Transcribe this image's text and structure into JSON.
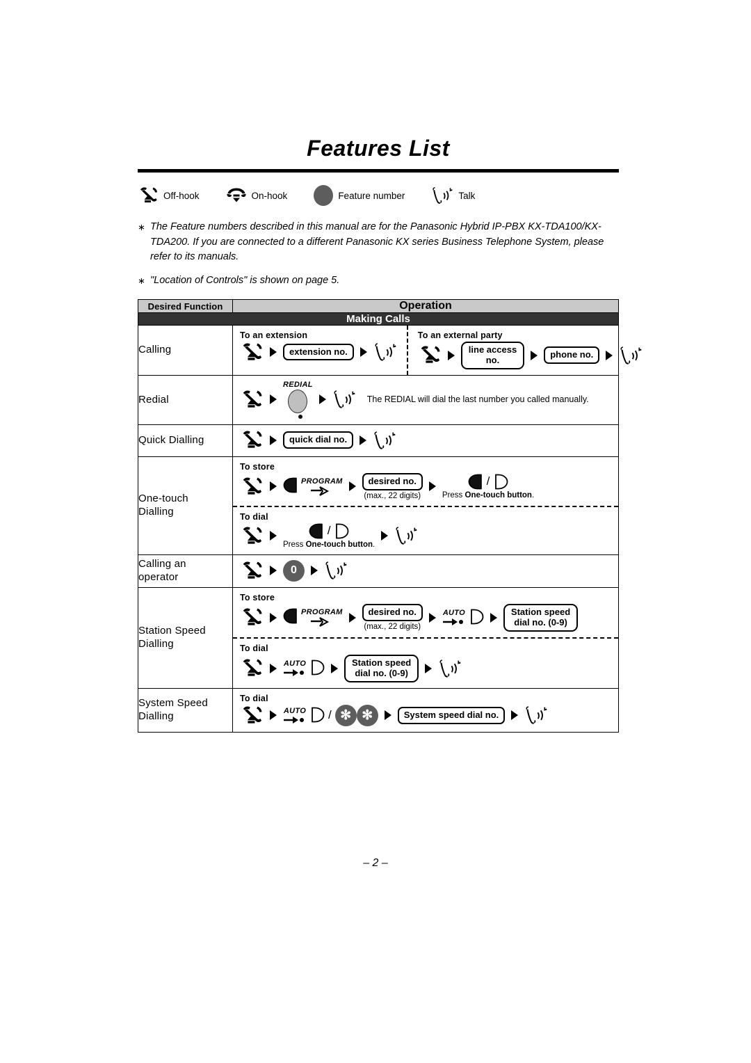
{
  "page": {
    "title": "Features List",
    "footer": "– 2 –"
  },
  "legend": [
    {
      "icon": "offhook-handset-icon",
      "label": "Off-hook"
    },
    {
      "icon": "onhook-handset-icon",
      "label": "On-hook"
    },
    {
      "icon": "feature-number-circle-icon",
      "label": "Feature number"
    },
    {
      "icon": "talk-handset-icon",
      "label": "Talk"
    }
  ],
  "notes": [
    {
      "marker": "∗",
      "text": "The Feature numbers described in this manual are for the Panasonic Hybrid IP-PBX KX-TDA100/KX-TDA200.  If you are connected to a different Panasonic KX series Business Telephone System, please refer to its manuals."
    },
    {
      "marker": "∗",
      "text": "\"Location of Controls\" is shown on page 5."
    }
  ],
  "table": {
    "headers": {
      "function": "Desired Function",
      "operation": "Operation"
    },
    "section": "Making Calls",
    "rows": [
      {
        "function": "Calling",
        "split": true,
        "left": {
          "label": "To an extension",
          "steps": [
            {
              "type": "offhook"
            },
            {
              "type": "arrow"
            },
            {
              "type": "box",
              "text": "extension no."
            },
            {
              "type": "arrow"
            },
            {
              "type": "talk"
            }
          ]
        },
        "right": {
          "label": "To an external party",
          "steps": [
            {
              "type": "offhook"
            },
            {
              "type": "arrow"
            },
            {
              "type": "box2",
              "line1": "line access",
              "line2": "no."
            },
            {
              "type": "arrow"
            },
            {
              "type": "box",
              "text": "phone no."
            },
            {
              "type": "arrow"
            },
            {
              "type": "talk"
            }
          ]
        }
      },
      {
        "function": "Redial",
        "sub": [
          {
            "label": "",
            "steps": [
              {
                "type": "offhook"
              },
              {
                "type": "arrow"
              },
              {
                "type": "redial",
                "toplabel": "REDIAL"
              },
              {
                "type": "arrow"
              },
              {
                "type": "talk"
              },
              {
                "type": "note",
                "text": "The REDIAL will dial the last number you called manually."
              }
            ]
          }
        ]
      },
      {
        "function": "Quick Dialling",
        "sub": [
          {
            "label": "",
            "steps": [
              {
                "type": "offhook"
              },
              {
                "type": "arrow"
              },
              {
                "type": "box",
                "text": "quick dial no."
              },
              {
                "type": "arrow"
              },
              {
                "type": "talk"
              }
            ]
          }
        ]
      },
      {
        "function": "One-touch Dialling",
        "function_lines": [
          "One-touch",
          "Dialling"
        ],
        "sub": [
          {
            "label": "To  store",
            "steps": [
              {
                "type": "offhook"
              },
              {
                "type": "arrow"
              },
              {
                "type": "progkey",
                "toplabel": "PROGRAM"
              },
              {
                "type": "arrow"
              },
              {
                "type": "box",
                "text": "desired no.",
                "caption": "(max., 22 digits)"
              },
              {
                "type": "arrow"
              },
              {
                "type": "twokeys",
                "caption_pre": "Press ",
                "caption_bold": "One-touch button",
                "caption_post": "."
              }
            ]
          },
          {
            "label": "To dial",
            "dashed_top": true,
            "steps": [
              {
                "type": "offhook"
              },
              {
                "type": "arrow"
              },
              {
                "type": "twokeys",
                "caption_pre": "Press ",
                "caption_bold": "One-touch button",
                "caption_post": "."
              },
              {
                "type": "arrow"
              },
              {
                "type": "talk"
              }
            ]
          }
        ]
      },
      {
        "function": "Calling an operator",
        "function_lines": [
          "Calling an",
          "operator"
        ],
        "sub": [
          {
            "label": "",
            "steps": [
              {
                "type": "offhook"
              },
              {
                "type": "arrow"
              },
              {
                "type": "featnum",
                "text": "0"
              },
              {
                "type": "arrow"
              },
              {
                "type": "talk"
              }
            ]
          }
        ]
      },
      {
        "function": "Station Speed Dialling",
        "function_lines": [
          "Station Speed",
          "Dialling"
        ],
        "sub": [
          {
            "label": "To store",
            "steps": [
              {
                "type": "offhook"
              },
              {
                "type": "arrow"
              },
              {
                "type": "progkey",
                "toplabel": "PROGRAM"
              },
              {
                "type": "arrow"
              },
              {
                "type": "box",
                "text": "desired no.",
                "caption": "(max., 22 digits)"
              },
              {
                "type": "arrow"
              },
              {
                "type": "autokey",
                "toplabel": "AUTO"
              },
              {
                "type": "arrow"
              },
              {
                "type": "box2",
                "line1": "Station speed",
                "line2": "dial no. (0-9)"
              }
            ]
          },
          {
            "label": "To dial",
            "dashed_top": true,
            "steps": [
              {
                "type": "offhook"
              },
              {
                "type": "arrow"
              },
              {
                "type": "autokey",
                "toplabel": "AUTO"
              },
              {
                "type": "arrow"
              },
              {
                "type": "box2",
                "line1": "Station speed",
                "line2": "dial no. (0-9)"
              },
              {
                "type": "arrow"
              },
              {
                "type": "talk"
              }
            ]
          }
        ]
      },
      {
        "function": "System Speed Dialling",
        "function_lines": [
          "System Speed",
          "Dialling"
        ],
        "sub": [
          {
            "label": "To dial",
            "steps": [
              {
                "type": "offhook"
              },
              {
                "type": "arrow"
              },
              {
                "type": "autokey_stars",
                "toplabel": "AUTO",
                "star": "✻"
              },
              {
                "type": "arrow"
              },
              {
                "type": "box",
                "text": "System speed dial no."
              },
              {
                "type": "arrow"
              },
              {
                "type": "talk"
              }
            ]
          }
        ]
      }
    ]
  }
}
